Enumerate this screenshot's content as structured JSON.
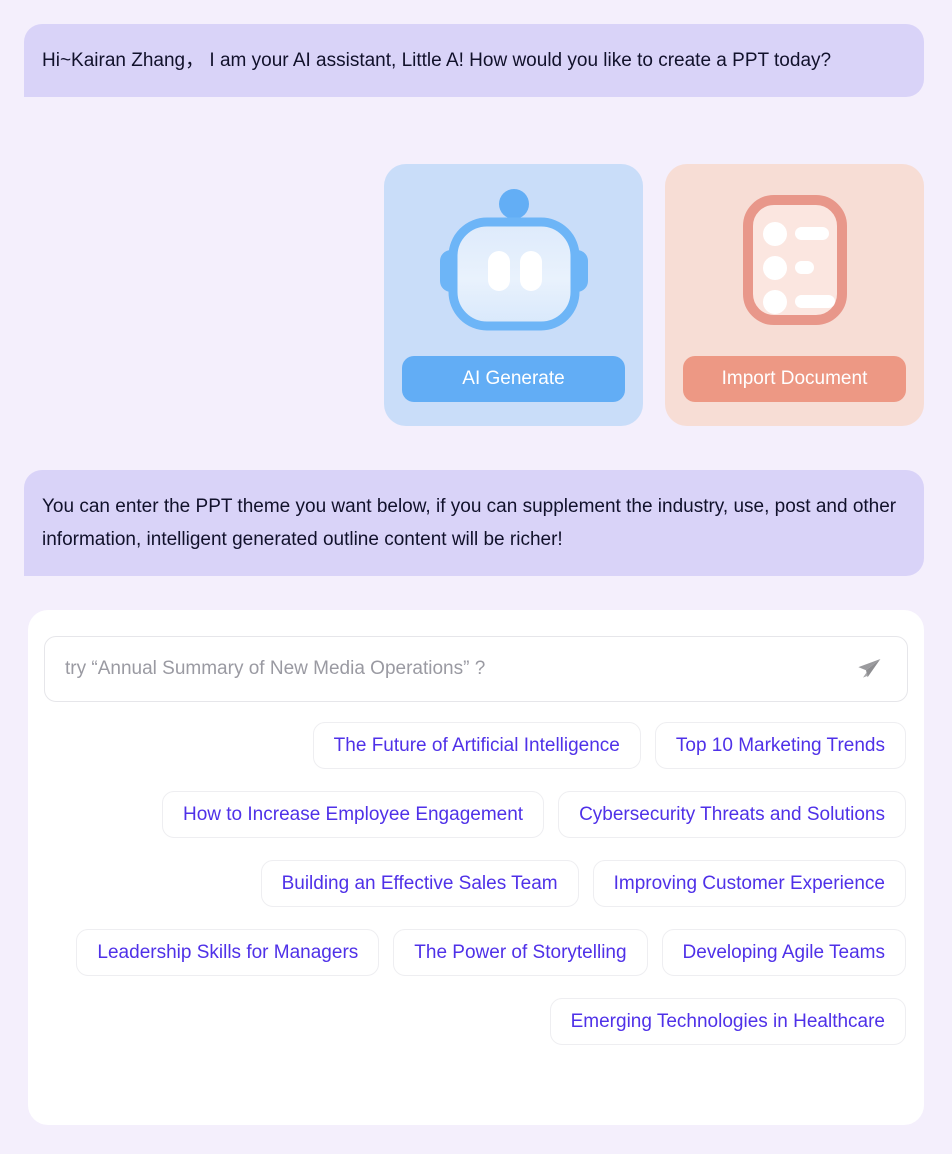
{
  "theme": {
    "page_background": "#F4EFFC",
    "bubble_background": "#D9D3F8",
    "panel_background": "#FFFFFF",
    "chip_text_color": "#4F31E8",
    "ai_card_background": "#C9DDF9",
    "ai_button_color": "#62ADF5",
    "import_card_background": "#F7DDD5",
    "import_button_color": "#ED9884"
  },
  "messages": [
    {
      "id": "greeting",
      "text": "Hi~Kairan Zhang， I am your AI assistant, Little A! How would you like to create a PPT today?"
    },
    {
      "id": "prompt",
      "text": "You can enter the PPT theme you want below, if you can supplement the industry, use, post and other information, intelligent generated outline content will be richer!"
    }
  ],
  "cards": [
    {
      "id": "ai-generate",
      "icon": "robot-icon",
      "button_label": "AI Generate"
    },
    {
      "id": "import-document",
      "icon": "document-list-icon",
      "button_label": "Import Document"
    }
  ],
  "composer": {
    "input_value": "",
    "input_placeholder": "try “Annual Summary of New Media Operations” ?",
    "send_icon": "send-plane-icon"
  },
  "suggestions": [
    "The Future of Artificial Intelligence",
    "Top 10 Marketing Trends",
    "How to Increase Employee Engagement",
    "Cybersecurity Threats and Solutions",
    "Building an Effective Sales Team",
    "Improving Customer Experience",
    "Leadership Skills for Managers",
    "The Power of Storytelling",
    "Developing Agile Teams",
    "Emerging Technologies in Healthcare"
  ]
}
